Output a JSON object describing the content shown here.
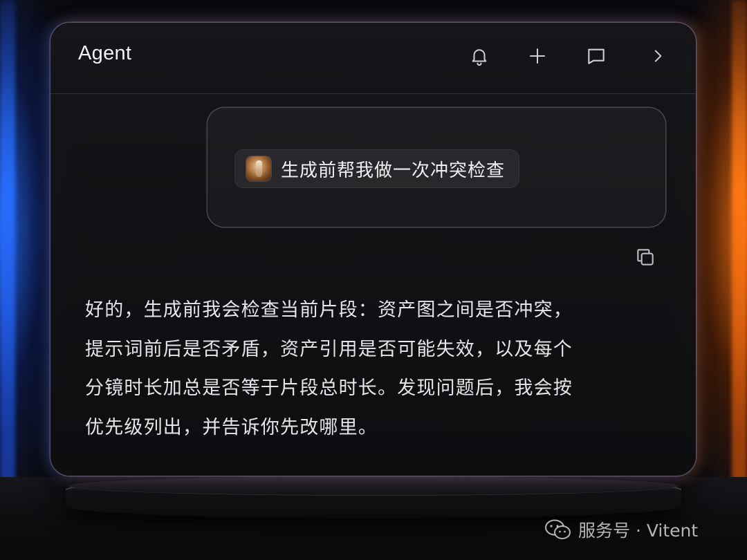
{
  "header": {
    "title": "Agent",
    "buttons": [
      "bell-icon",
      "plus-icon",
      "chat-icon",
      "chevron-right-icon"
    ]
  },
  "user_message": {
    "text": "生成前帮我做一次冲突检查"
  },
  "assistant_message": {
    "lines": [
      "好的，生成前我会检查当前片段：资产图之间是否冲突，",
      "提示词前后是否矛盾，资产引用是否可能失效，以及每个",
      "分镜时长加总是否等于片段总时长。发现问题后，我会按",
      "优先级列出，并告诉你先改哪里。"
    ]
  },
  "watermark": {
    "text": "服务号 · Vitent"
  },
  "colors": {
    "left_glow": "#2870ff",
    "right_glow": "#ff7814",
    "panel_bg": "#141418",
    "text": "#e6e6ea"
  }
}
